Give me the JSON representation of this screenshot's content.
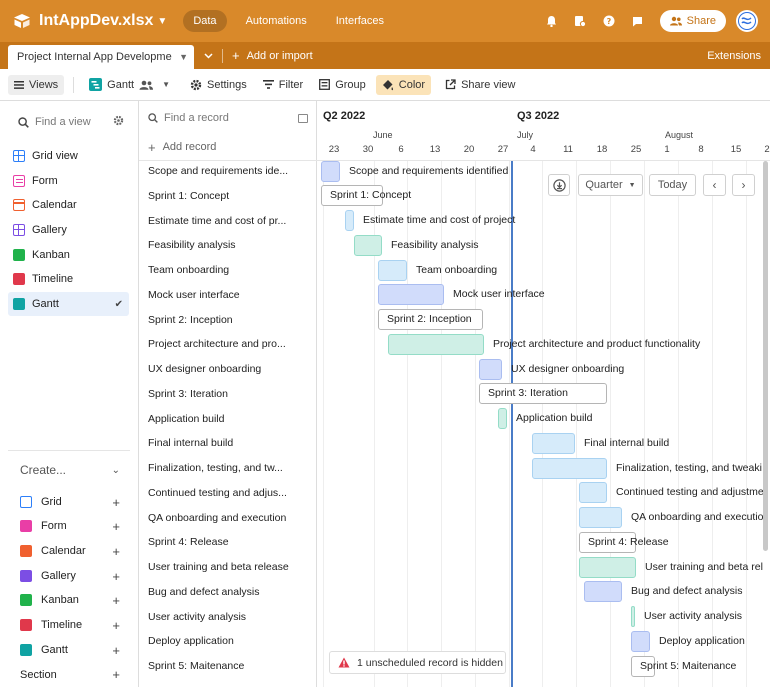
{
  "app": {
    "title": "IntAppDev.xlsx",
    "nav": [
      "Data",
      "Automations",
      "Interfaces"
    ],
    "share_label": "Share",
    "brand_color": "#d9892a"
  },
  "tabbar": {
    "active_tab": "Project Internal App Developme",
    "add_import": "Add or import",
    "extensions": "Extensions"
  },
  "toolbar": {
    "views": "Views",
    "view_name": "Gantt",
    "settings": "Settings",
    "filter": "Filter",
    "group": "Group",
    "color": "Color",
    "share_view": "Share view"
  },
  "sidebar": {
    "find_placeholder": "Find a view",
    "views": [
      {
        "label": "Grid view",
        "color": "#2d7ff9"
      },
      {
        "label": "Form",
        "color": "#e93ea6"
      },
      {
        "label": "Calendar",
        "color": "#f0602f"
      },
      {
        "label": "Gallery",
        "color": "#7c4ee4"
      },
      {
        "label": "Kanban",
        "color": "#20b24b"
      },
      {
        "label": "Timeline",
        "color": "#e0384b"
      },
      {
        "label": "Gantt",
        "color": "#10a3a3"
      }
    ],
    "create_label": "Create...",
    "create_items": [
      {
        "label": "Grid",
        "color": "#2d7ff9"
      },
      {
        "label": "Form",
        "color": "#e93ea6"
      },
      {
        "label": "Calendar",
        "color": "#f0602f"
      },
      {
        "label": "Gallery",
        "color": "#7c4ee4"
      },
      {
        "label": "Kanban",
        "color": "#20b24b"
      },
      {
        "label": "Timeline",
        "color": "#e0384b"
      },
      {
        "label": "Gantt",
        "color": "#10a3a3"
      }
    ],
    "section_label": "Section"
  },
  "records": {
    "find_placeholder": "Find a record",
    "add_label": "Add record",
    "items": [
      "Scope and requirements ide...",
      "Sprint 1: Concept",
      "Estimate time and cost of pr...",
      "Feasibility analysis",
      "Team onboarding",
      "Mock user interface",
      "Sprint 2: Inception",
      "Project architecture and pro...",
      "UX designer onboarding",
      "Sprint 3: Iteration",
      "Application build",
      "Final internal build",
      "Finalization, testing, and tw...",
      "Continued testing and adjus...",
      "QA onboarding and execution",
      "Sprint 4: Release",
      "User training and beta release",
      "Bug and defect analysis",
      "User activity analysis",
      "Deploy application",
      "Sprint 5: Maitenance"
    ]
  },
  "gantt": {
    "quarters": [
      "Q2 2022",
      "Q3 2022"
    ],
    "months": [
      "June",
      "July",
      "August"
    ],
    "days": [
      "23",
      "30",
      "6",
      "13",
      "20",
      "27",
      "4",
      "11",
      "18",
      "25",
      "1",
      "8",
      "15",
      "2"
    ],
    "controls": {
      "zoom": "Quarter",
      "today": "Today"
    },
    "unscheduled": "1 unscheduled record is hidden",
    "bars": [
      {
        "label": "Scope and requirements identified",
        "style": "blue"
      },
      {
        "label": "Sprint 1: Concept",
        "style": "white"
      },
      {
        "label": "Estimate time and cost of project",
        "style": "lightblue"
      },
      {
        "label": "Feasibility analysis",
        "style": "teal"
      },
      {
        "label": "Team onboarding",
        "style": "lightblue"
      },
      {
        "label": "Mock user interface",
        "style": "blue"
      },
      {
        "label": "Sprint 2: Inception",
        "style": "white"
      },
      {
        "label": "Project architecture and product functionality",
        "style": "teal"
      },
      {
        "label": "UX designer onboarding",
        "style": "blue"
      },
      {
        "label": "Sprint 3: Iteration",
        "style": "white"
      },
      {
        "label": "Application build",
        "style": "teal"
      },
      {
        "label": "Final internal build",
        "style": "lightblue"
      },
      {
        "label": "Finalization, testing, and tweaki",
        "style": "lightblue"
      },
      {
        "label": "Continued testing and adjustme",
        "style": "lightblue"
      },
      {
        "label": "QA onboarding and executio",
        "style": "lightblue"
      },
      {
        "label": "Sprint 4: Release",
        "style": "white"
      },
      {
        "label": "User training and beta rel",
        "style": "teal"
      },
      {
        "label": "Bug and defect analysis",
        "style": "blue"
      },
      {
        "label": "User activity analysis",
        "style": "teal"
      },
      {
        "label": "Deploy application",
        "style": "blue"
      },
      {
        "label": "Sprint 5: Maitenance",
        "style": "white"
      }
    ]
  }
}
